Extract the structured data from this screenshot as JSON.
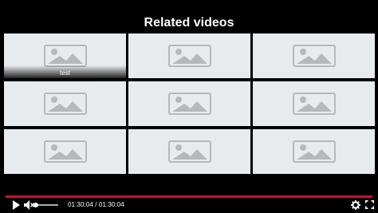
{
  "header": {
    "title": "Related videos"
  },
  "related_videos": [
    {
      "caption": "test",
      "thumb_icon": "image-placeholder-icon"
    },
    {
      "caption": "",
      "thumb_icon": "image-placeholder-icon"
    },
    {
      "caption": "",
      "thumb_icon": "image-placeholder-icon"
    },
    {
      "caption": "",
      "thumb_icon": "image-placeholder-icon"
    },
    {
      "caption": "",
      "thumb_icon": "image-placeholder-icon"
    },
    {
      "caption": "",
      "thumb_icon": "image-placeholder-icon"
    },
    {
      "caption": "",
      "thumb_icon": "image-placeholder-icon"
    },
    {
      "caption": "",
      "thumb_icon": "image-placeholder-icon"
    },
    {
      "caption": "",
      "thumb_icon": "image-placeholder-icon"
    }
  ],
  "player": {
    "progress": 1.0,
    "volume": 0.0,
    "muted": true,
    "time_display": "01:30:04 / 01:30:04",
    "icons": {
      "play": "play-icon",
      "mute": "volume-muted-icon",
      "settings": "gear-icon",
      "fullscreen": "fullscreen-icon"
    }
  },
  "colors": {
    "background": "#000000",
    "tile_background": "#e8ebee",
    "placeholder_icon": "#b5b9bd",
    "progress": "#c8102e",
    "text": "#ffffff"
  }
}
